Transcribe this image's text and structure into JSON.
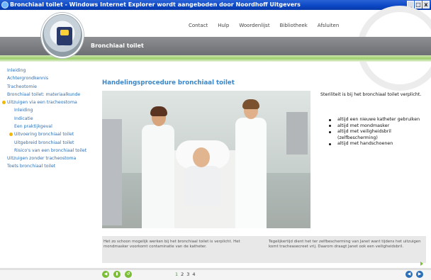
{
  "window": {
    "title": "Bronchiaal toilet - Windows Internet Explorer wordt aangeboden door Noordhoff Uitgevers",
    "buttons": [
      "_",
      "□",
      "x"
    ]
  },
  "topnav": [
    "Contact",
    "Hulp",
    "Woordenlijst",
    "Bibliotheek",
    "Afsluiten"
  ],
  "banner": {
    "title": "Bronchiaal toilet"
  },
  "sidebar": {
    "items": [
      {
        "label": "Inleiding",
        "level": 0,
        "active": false
      },
      {
        "label": "Achtergrondkennis",
        "level": 0,
        "active": false
      },
      {
        "label": "Tracheotomie",
        "level": 0,
        "active": false
      },
      {
        "label": "Bronchiaal toilet: materiaalkunde",
        "level": 0,
        "active": false
      },
      {
        "label": "Uitzuigen via een tracheostoma",
        "level": 0,
        "active": true
      },
      {
        "label": "Inleiding",
        "level": 1,
        "active": false
      },
      {
        "label": "Indicatie",
        "level": 1,
        "active": false
      },
      {
        "label": "Een praktijkgeval",
        "level": 1,
        "active": false
      },
      {
        "label": "Uitvoering bronchiaal toilet",
        "level": 1,
        "active": true
      },
      {
        "label": "Uitgebreid bronchiaal toilet",
        "level": 1,
        "active": false
      },
      {
        "label": "Risico's van een bronchiaal toilet",
        "level": 1,
        "active": false
      },
      {
        "label": "Uitzuigen zonder tracheostoma",
        "level": 0,
        "active": false
      },
      {
        "label": "Toets bronchiaal toilet",
        "level": 0,
        "active": false
      }
    ]
  },
  "main": {
    "heading": "Handelingsprocedure bronchiaal toilet",
    "intro": "Steriliteit is bij het bronchiaal toilet verplicht.",
    "bullets": [
      "altijd een nieuwe katheter gebruiken",
      "altijd met mondmasker",
      "altijd met veiligheidsbril (zelfbescherming)",
      "altijd met handschoenen"
    ]
  },
  "captions": {
    "left": "Het zo schoon mogelijk werken bij het bronchiaal toilet is verplicht. Het mondmasker voorkomt contaminatie van de katheter.",
    "right": "Tegelijkertijd dient het ter zelfbescherming van Janet want tijdens het uitzuigen komt tracheasecreet vrij. Daarom draagt Janet ook een veiligheidsbril."
  },
  "footer": {
    "pages": [
      "1",
      "2",
      "3",
      "4"
    ],
    "current_page": "1",
    "left_buttons": [
      "◀",
      "▮",
      "↺"
    ],
    "right_buttons": [
      "◀",
      "▶"
    ]
  },
  "colors": {
    "link": "#2b6fb6",
    "heading": "#3a86c9",
    "accent_green": "#7bbd34",
    "bullet_active": "#f2b800"
  }
}
